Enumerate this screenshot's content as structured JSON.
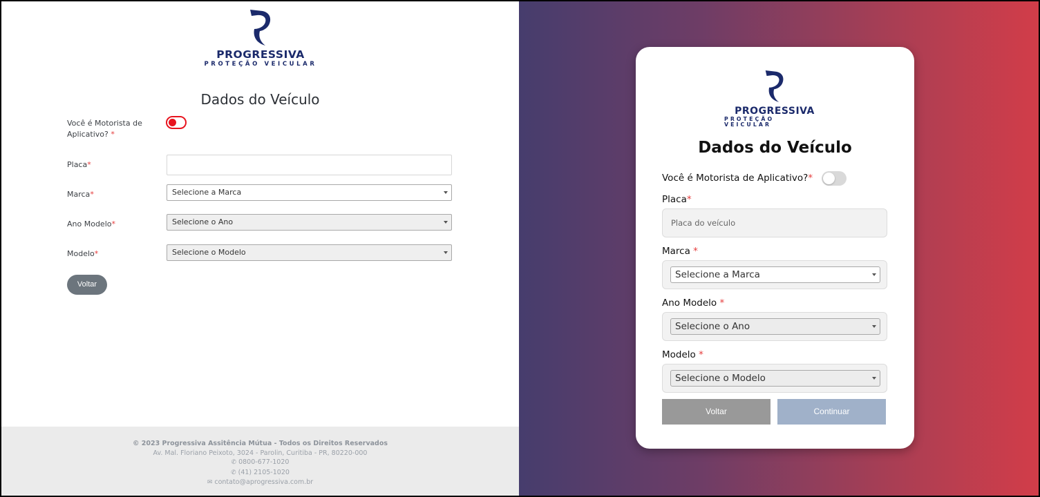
{
  "brand": {
    "name": "PROGRESSIVA",
    "tagline": "PROTEÇÃO VEICULAR",
    "color": "#1b2a6b"
  },
  "left": {
    "title": "Dados do Veículo",
    "driver_label": "Você é Motorista de Aplicativo?",
    "plate_label": "Placa",
    "brand_label": "Marca",
    "year_label": "Ano Modelo",
    "model_label": "Modelo",
    "required_mark": "*",
    "brand_select": "Selecione a Marca",
    "year_select": "Selecione o Ano",
    "model_select": "Selecione o Modelo",
    "back_button": "Voltar",
    "toggle_color": "#e8141e"
  },
  "footer": {
    "copyright": "© 2023 Progressiva Assitência Mútua - Todos os Direitos Reservados",
    "address": "Av. Mal. Floriano Peixoto, 3024 - Parolin, Curitiba - PR, 80220-000",
    "phone1": "0800-677-1020",
    "phone2": "(41) 2105-1020",
    "email": "contato@aprogressiva.com.br"
  },
  "right": {
    "title": "Dados do Veículo",
    "driver_label": "Você é Motorista de Aplicativo?",
    "plate_label": "Placa",
    "plate_placeholder": "Placa do veículo",
    "brand_label": "Marca ",
    "year_label": "Ano Modelo ",
    "model_label": "Modelo ",
    "required_mark": "*",
    "brand_select": "Selecione a Marca",
    "year_select": "Selecione o Ano",
    "model_select": "Selecione o Modelo",
    "back_button": "Voltar",
    "continue_button": "Continuar",
    "gradient_start": "#463d6d",
    "gradient_end": "#d23d49"
  }
}
